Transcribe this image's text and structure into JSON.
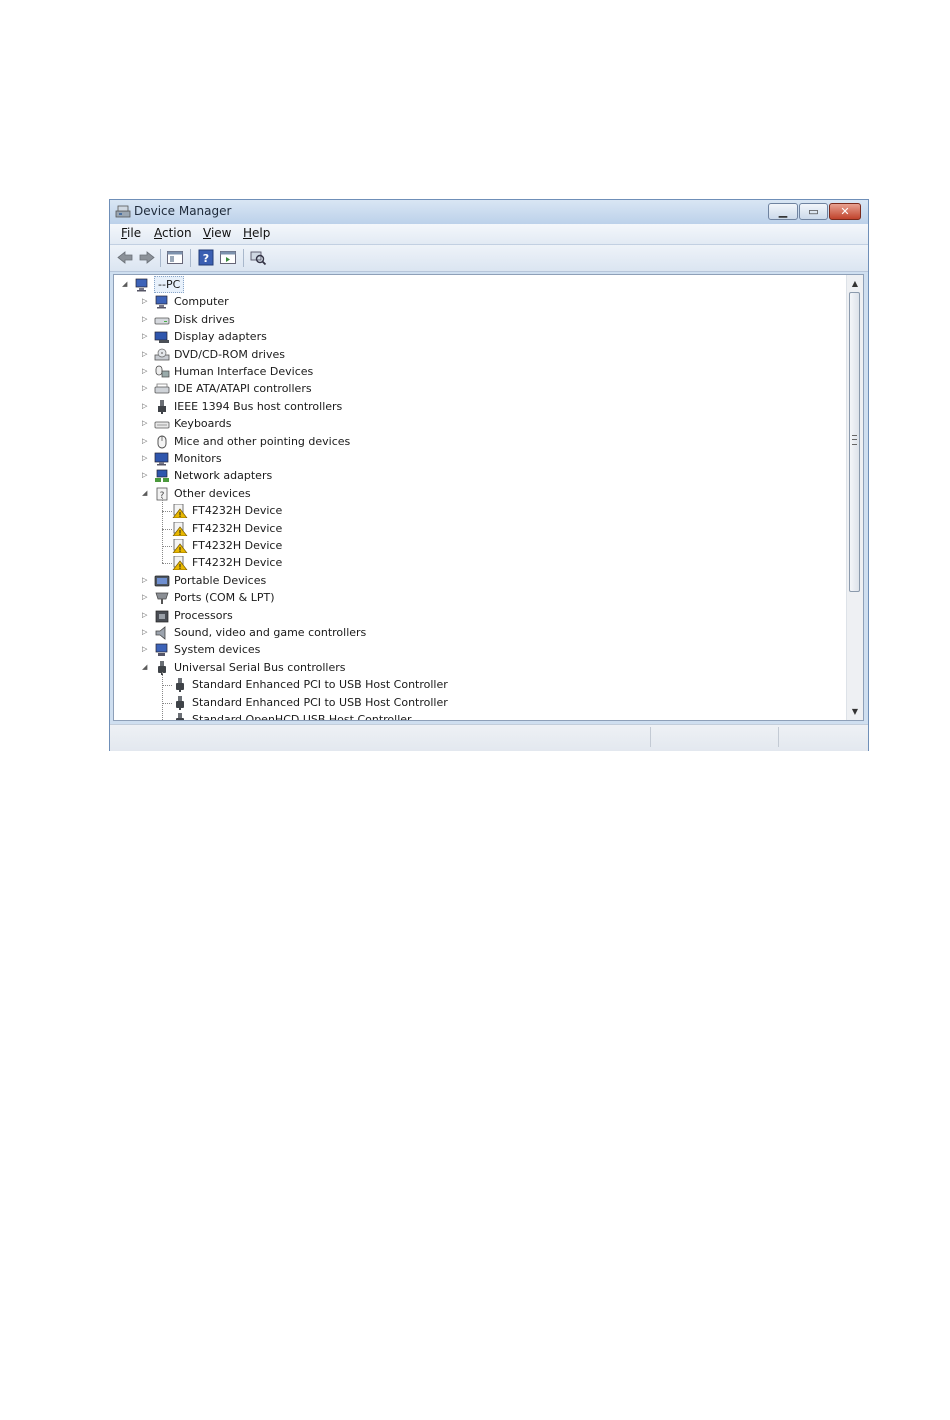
{
  "window": {
    "title": "Device Manager",
    "icon": "device-manager-icon",
    "controls": [
      "minimize-icon",
      "maximize-icon",
      "close-icon"
    ]
  },
  "menu": [
    {
      "key": "F",
      "rest": "ile"
    },
    {
      "key": "A",
      "rest": "ction"
    },
    {
      "key": "V",
      "rest": "iew"
    },
    {
      "key": "H",
      "rest": "elp"
    }
  ],
  "toolbar": [
    "back-icon",
    "forward-icon",
    "show-hide-console-tree-icon",
    "help-icon",
    "properties-icon",
    "scan-hardware-icon"
  ],
  "tree": {
    "root": {
      "label": "--PC",
      "icon": "computer-icon",
      "expanded": true
    },
    "categories": [
      {
        "label": "Computer",
        "icon": "computer-icon",
        "expanded": false
      },
      {
        "label": "Disk drives",
        "icon": "disk-drive-icon",
        "expanded": false
      },
      {
        "label": "Display adapters",
        "icon": "display-adapter-icon",
        "expanded": false
      },
      {
        "label": "DVD/CD-ROM drives",
        "icon": "dvd-drive-icon",
        "expanded": false
      },
      {
        "label": "Human Interface Devices",
        "icon": "hid-icon",
        "expanded": false
      },
      {
        "label": "IDE ATA/ATAPI controllers",
        "icon": "ide-controller-icon",
        "expanded": false
      },
      {
        "label": "IEEE 1394 Bus host controllers",
        "icon": "ieee1394-icon",
        "expanded": false
      },
      {
        "label": "Keyboards",
        "icon": "keyboard-icon",
        "expanded": false
      },
      {
        "label": "Mice and other pointing devices",
        "icon": "mouse-icon",
        "expanded": false
      },
      {
        "label": "Monitors",
        "icon": "monitor-icon",
        "expanded": false
      },
      {
        "label": "Network adapters",
        "icon": "network-adapter-icon",
        "expanded": false
      },
      {
        "label": "Other devices",
        "icon": "unknown-device-icon",
        "expanded": true,
        "children": [
          {
            "label": "FT4232H Device",
            "icon": "warning-device-icon"
          },
          {
            "label": "FT4232H Device",
            "icon": "warning-device-icon"
          },
          {
            "label": "FT4232H Device",
            "icon": "warning-device-icon"
          },
          {
            "label": "FT4232H Device",
            "icon": "warning-device-icon"
          }
        ]
      },
      {
        "label": "Portable Devices",
        "icon": "portable-device-icon",
        "expanded": false
      },
      {
        "label": "Ports (COM & LPT)",
        "icon": "port-icon",
        "expanded": false
      },
      {
        "label": "Processors",
        "icon": "processor-icon",
        "expanded": false
      },
      {
        "label": "Sound, video and game controllers",
        "icon": "sound-icon",
        "expanded": false
      },
      {
        "label": "System devices",
        "icon": "system-device-icon",
        "expanded": false
      },
      {
        "label": "Universal Serial Bus controllers",
        "icon": "usb-icon",
        "expanded": true,
        "children": [
          {
            "label": "Standard Enhanced PCI to USB Host Controller",
            "icon": "usb-icon"
          },
          {
            "label": "Standard Enhanced PCI to USB Host Controller",
            "icon": "usb-icon"
          },
          {
            "label": "Standard OpenHCD USB Host Controller",
            "icon": "usb-icon"
          }
        ]
      }
    ]
  },
  "colors": {
    "warning": "#e8b800",
    "selection_border": "#8aa6c8",
    "titlebar": "#c8d9ee"
  }
}
